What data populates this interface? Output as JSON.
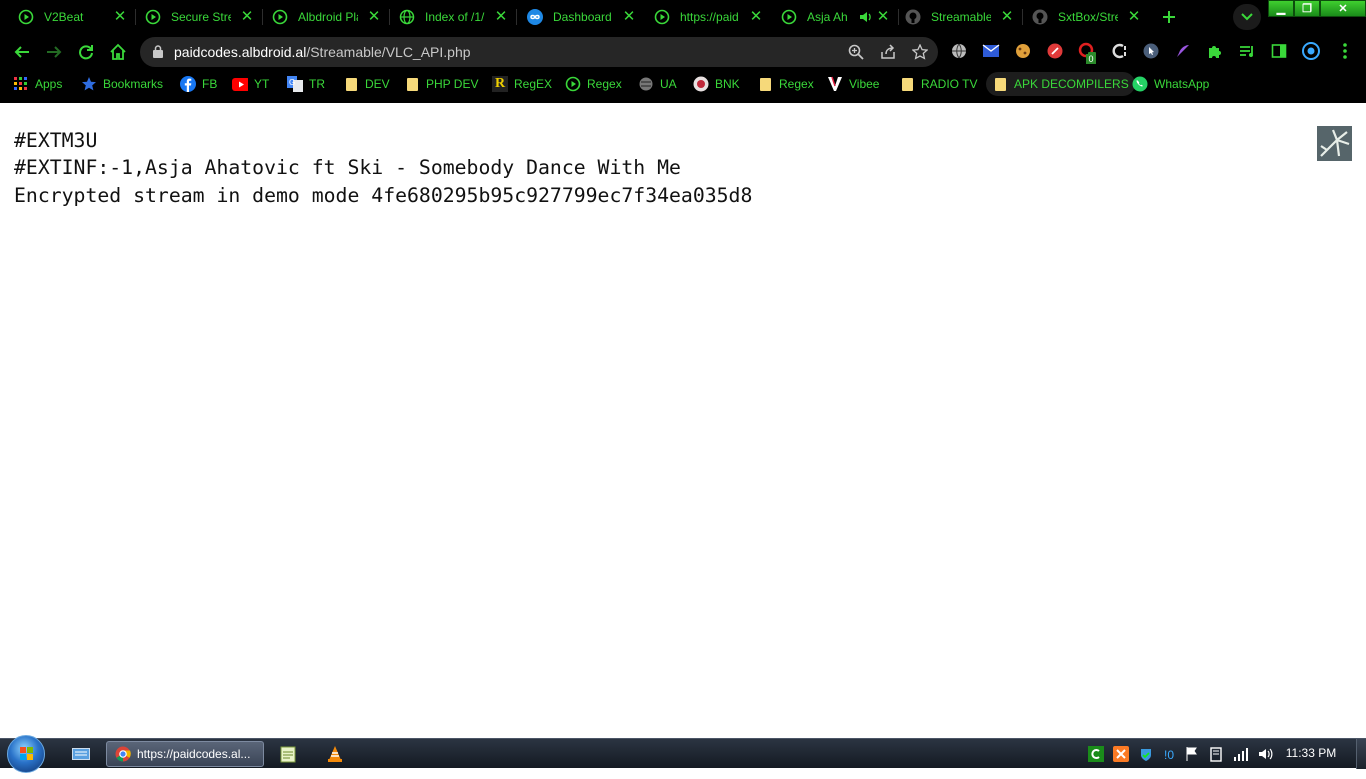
{
  "browser": {
    "tabs": [
      {
        "title": "V2Beat",
        "icon": "play-circle-icon"
      },
      {
        "title": "Secure Stre",
        "icon": "play-circle-icon"
      },
      {
        "title": "Albdroid Pla",
        "icon": "play-circle-icon"
      },
      {
        "title": "Index of /1/",
        "icon": "globe-icon"
      },
      {
        "title": "Dashboard",
        "icon": "infinity-icon"
      },
      {
        "title": "https://paid",
        "icon": "play-circle-icon",
        "active": true
      },
      {
        "title": "Asja Ah",
        "icon": "play-circle-icon",
        "audio": true
      },
      {
        "title": "Streamable",
        "icon": "github-icon"
      },
      {
        "title": "SxtBox/Stre",
        "icon": "github-icon"
      }
    ],
    "new_tab_label": "+",
    "address": {
      "host": "paidcodes.albdroid.al",
      "path": "/Streamable/VLC_API.php"
    },
    "extension_badge": "0",
    "bookmarks": [
      {
        "label": "Apps",
        "icon": "apps-grid-icon"
      },
      {
        "label": "Bookmarks",
        "icon": "star-icon"
      },
      {
        "label": "FB",
        "icon": "facebook-icon"
      },
      {
        "label": "YT",
        "icon": "youtube-icon"
      },
      {
        "label": "TR",
        "icon": "translate-icon"
      },
      {
        "label": "DEV",
        "icon": "folder-icon"
      },
      {
        "label": "PHP DEV",
        "icon": "folder-icon"
      },
      {
        "label": "RegEX",
        "icon": "regex-r-icon"
      },
      {
        "label": "Regex",
        "icon": "play-circle-icon"
      },
      {
        "label": "UA",
        "icon": "globe-icon"
      },
      {
        "label": "BNK",
        "icon": "bank-icon"
      },
      {
        "label": "Regex",
        "icon": "folder-icon"
      },
      {
        "label": "Vibee",
        "icon": "vibee-v-icon"
      },
      {
        "label": "RADIO TV",
        "icon": "folder-icon"
      },
      {
        "label": "APK DECOMPILERS",
        "icon": "folder-icon"
      },
      {
        "label": "WhatsApp",
        "icon": "whatsapp-icon"
      }
    ],
    "colors": {
      "accent": "#3ad83a",
      "chrome_bg": "#000000",
      "omnibox_bg": "#262626"
    }
  },
  "page": {
    "lines": [
      "#EXTM3U",
      "#EXTINF:-1,Asja Ahatovic ft Ski - Somebody Dance With Me",
      "Encrypted stream in demo mode 4fe680295b95c927799ec7f34ea035d8"
    ]
  },
  "taskbar": {
    "task_label": "https://paidcodes.al...",
    "clock": "11:33 PM"
  }
}
